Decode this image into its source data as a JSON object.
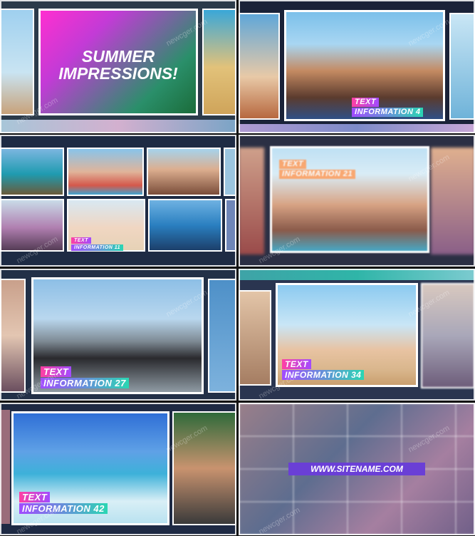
{
  "panels": {
    "title_card": {
      "line1": "SUMMER",
      "line2": "IMPRESSIONS!"
    },
    "p2_tag": {
      "line1": "TEXT",
      "line2": "INFORMATION 4"
    },
    "p3_tag": {
      "line1": "TEXT",
      "line2": "INFORMATION 11"
    },
    "p4_tag": {
      "line1": "TEXT",
      "line2": "INFORMATION 21"
    },
    "p5_tag": {
      "line1": "TEXT",
      "line2": "INFORMATION 27"
    },
    "p6_tag": {
      "line1": "TEXT",
      "line2": "INFORMATION 34"
    },
    "p7_tag": {
      "line1": "TEXT",
      "line2": "INFORMATION 42"
    },
    "site": {
      "url": "WWW.SITENAME.COM"
    }
  },
  "watermark": "newcger.com",
  "colors": {
    "pink": "#ff3fa3",
    "purple": "#a24bff",
    "teal": "#2ad6b3",
    "url_bar": "#6a3fd6"
  }
}
